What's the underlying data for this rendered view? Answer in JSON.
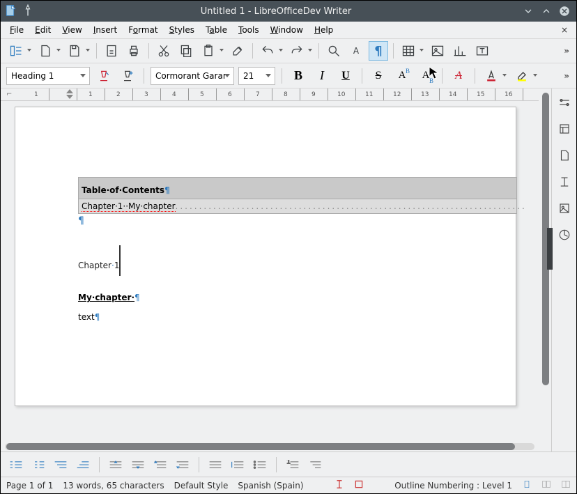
{
  "titlebar": {
    "title": "Untitled 1 - LibreOfficeDev Writer"
  },
  "menu": {
    "file": "File",
    "edit": "Edit",
    "view": "View",
    "insert": "Insert",
    "format": "Format",
    "styles": "Styles",
    "table": "Table",
    "tools": "Tools",
    "window": "Window",
    "help": "Help"
  },
  "format_bar": {
    "style": "Heading 1",
    "font": "Cormorant Garar",
    "size": "21",
    "bold": "B",
    "italic": "I",
    "underline": "U",
    "strike": "S",
    "super": "A",
    "sub": "A",
    "clear": "A"
  },
  "ruler": {
    "nums": [
      "1",
      "1",
      "2",
      "3",
      "4",
      "5",
      "6",
      "7",
      "8",
      "9",
      "10",
      "11",
      "12",
      "13",
      "14",
      "15",
      "16"
    ]
  },
  "doc": {
    "toc_title": "Table·of·Contents",
    "toc_entry": "Chapter·1··My·chapter",
    "heading": "Chapter",
    "heading_num": "1",
    "subheading": "My·chapter·",
    "body": "text",
    "pilcrow": "¶"
  },
  "status": {
    "page": "Page 1 of 1",
    "words": "13 words, 65 characters",
    "style": "Default Style",
    "lang": "Spanish (Spain)",
    "outline": "Outline Numbering : Level 1"
  }
}
